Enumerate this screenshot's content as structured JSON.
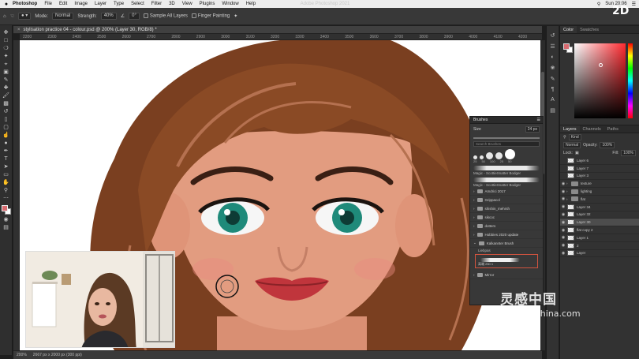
{
  "menubar": {
    "app": "Photoshop",
    "items": [
      "File",
      "Edit",
      "Image",
      "Layer",
      "Type",
      "Select",
      "Filter",
      "3D",
      "View",
      "Plugins",
      "Window",
      "Help"
    ],
    "clock": "Sun 20:06"
  },
  "app_title": "Adobe Photoshop 2021",
  "options": {
    "mode_label": "Mode:",
    "mode_value": "Normal",
    "strength_label": "Strength:",
    "strength_value": "40%",
    "angle_value": "0°",
    "sample_all_layers": "Sample All Layers",
    "finger_painting": "Finger Painting"
  },
  "document": {
    "tab_title": "stylisation practice 04 - colour.psd @ 200% (Layer 30, RGB/8) *",
    "zoom": "200%",
    "doc_size": "2667 px x 2000 px (300 ppi)"
  },
  "ruler_ticks": [
    "2200",
    "2300",
    "2400",
    "2500",
    "2600",
    "2700",
    "2800",
    "2900",
    "3000",
    "3100",
    "3200",
    "3300",
    "3400",
    "3500",
    "3600",
    "3700",
    "3800",
    "3900",
    "4000",
    "4100",
    "4200"
  ],
  "panels": {
    "color_tab": "Color",
    "swatches_tab": "Swatches",
    "layers_tab": "Layers",
    "channels_tab": "Channels",
    "paths_tab": "Paths",
    "kind": "Kind",
    "blend": "Normal",
    "opacity_label": "Opacity:",
    "opacity": "100%",
    "lock_label": "Lock:",
    "fill_label": "Fill:",
    "fill": "100%"
  },
  "layers": [
    {
      "name": "Layer 6",
      "type": "layer",
      "visible": false
    },
    {
      "name": "Layer 7",
      "type": "layer",
      "visible": false
    },
    {
      "name": "Layer 3",
      "type": "layer",
      "visible": false
    },
    {
      "name": "texture",
      "type": "group",
      "visible": true
    },
    {
      "name": "lighting",
      "type": "group",
      "visible": true
    },
    {
      "name": "flat",
      "type": "group",
      "visible": true
    },
    {
      "name": "Layer 34",
      "type": "layer",
      "visible": true
    },
    {
      "name": "Layer 32",
      "type": "layer",
      "visible": true
    },
    {
      "name": "Layer 30",
      "type": "layer",
      "visible": true,
      "selected": true
    },
    {
      "name": "flat copy 2",
      "type": "layer",
      "visible": true
    },
    {
      "name": "Layer 1",
      "type": "layer",
      "visible": true
    },
    {
      "name": "2",
      "type": "layer",
      "visible": true
    },
    {
      "name": "Layer",
      "type": "layer",
      "visible": true
    }
  ],
  "brushes": {
    "title": "Brushes",
    "size_label": "Size",
    "size_value": "24 px",
    "search_placeholder": "Search Brushes",
    "tip_sizes": [
      "25",
      "50",
      "100",
      "25",
      "50"
    ],
    "recent_1": "Magic - ScottieSnatter Bodger",
    "recent_2": "Magic - ScottieSnatter Bodger",
    "folders": [
      "Amdrici 2017",
      "Grippacol",
      "shishin_mehrsh",
      "sikcoc",
      "dotters",
      "Hobbies 2020 update",
      "Kalkannter Brush"
    ],
    "subfolder": "Liebpas",
    "preset_label": "高端 250 1",
    "other_folder": "Mirror"
  },
  "watermark": {
    "logo_text": "灵感中国",
    "url": "lingganchina.com",
    "corner": "2D"
  }
}
